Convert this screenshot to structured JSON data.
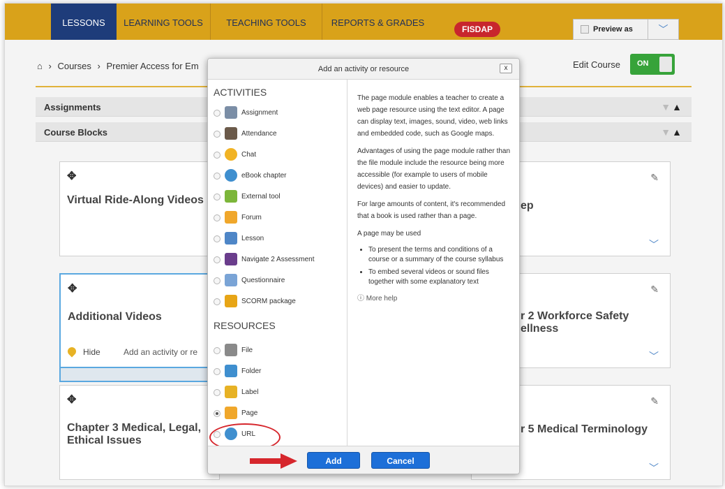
{
  "nav": {
    "tabs": [
      "LESSONS",
      "LEARNING TOOLS",
      "TEACHING TOOLS",
      "REPORTS & GRADES"
    ],
    "fisdap": "FISDAP",
    "preview_label": "Preview as",
    "dropdown_glyph": "﹀"
  },
  "breadcrumb": {
    "home_glyph": "⌂",
    "sep": "›",
    "items": [
      "Courses",
      "Premier Access for Em"
    ]
  },
  "edit_course": {
    "label": "Edit Course",
    "state": "ON"
  },
  "sections": {
    "assignments": "Assignments",
    "course_blocks": "Course Blocks"
  },
  "cards": [
    {
      "title": "Virtual Ride-Along Videos"
    },
    {
      "title": "Additional Videos",
      "hide_label": "Hide",
      "add_label": "Add an activity or re"
    },
    {
      "title": "Chapter 3 Medical, Legal,\nEthical Issues"
    },
    {
      "title": "ep"
    },
    {
      "title": "r 2 Workforce Safety\nellness"
    },
    {
      "title": "r 5 Medical Terminology"
    }
  ],
  "modal": {
    "title": "Add an activity or resource",
    "close": "x",
    "activities_heading": "ACTIVITIES",
    "resources_heading": "RESOURCES",
    "activities": [
      {
        "label": "Assignment",
        "icon": "assignment-icon",
        "color": "#7b8ea6"
      },
      {
        "label": "Attendance",
        "icon": "attendance-icon",
        "color": "#6b5a4a"
      },
      {
        "label": "Chat",
        "icon": "chat-icon",
        "color": "#f1b324"
      },
      {
        "label": "eBook chapter",
        "icon": "ebook-icon",
        "color": "#3f8fcf"
      },
      {
        "label": "External tool",
        "icon": "puzzle-icon",
        "color": "#7cb63a"
      },
      {
        "label": "Forum",
        "icon": "forum-icon",
        "color": "#f0a72b"
      },
      {
        "label": "Lesson",
        "icon": "lesson-icon",
        "color": "#4e86c7"
      },
      {
        "label": "Navigate 2 Assessment",
        "icon": "navigate-icon",
        "color": "#6a3d8c"
      },
      {
        "label": "Questionnaire",
        "icon": "questionnaire-icon",
        "color": "#7aa4d6"
      },
      {
        "label": "SCORM package",
        "icon": "scorm-icon",
        "color": "#e7a516"
      }
    ],
    "resources": [
      {
        "label": "File",
        "icon": "file-icon",
        "color": "#8a8a8a"
      },
      {
        "label": "Folder",
        "icon": "folder-icon",
        "color": "#3f8fcf"
      },
      {
        "label": "Label",
        "icon": "label-icon",
        "color": "#e7b225"
      },
      {
        "label": "Page",
        "icon": "page-icon",
        "color": "#f0a72b",
        "selected": true
      },
      {
        "label": "URL",
        "icon": "url-icon",
        "color": "#3f8fcf"
      }
    ],
    "description": {
      "p1": "The page module enables a teacher to create a web page resource using the text editor. A page can display text, images, sound, video, web links and embedded code, such as Google maps.",
      "p2": "Advantages of using the page module rather than the file module include the resource being more accessible (for example to users of mobile devices) and easier to update.",
      "p3": "For large amounts of content, it's recommended that a book is used rather than a page.",
      "p4": "A page may be used",
      "bullets": [
        "To present the terms and conditions of a course or a summary of the course syllabus",
        "To embed several videos or sound files together with some explanatory text"
      ],
      "more_help": "More help",
      "help_glyph": "ⓘ"
    },
    "add_button": "Add",
    "cancel_button": "Cancel"
  },
  "colors": {
    "nav_bg": "#d9a21a",
    "nav_active": "#1e3c7a",
    "primary_button": "#1d6fd8",
    "toggle_on": "#37a33a",
    "highlight_red": "#d6262c"
  },
  "glyphs": {
    "move": "✥",
    "pencil": "✎",
    "chevron": "﹀",
    "up": "▲",
    "down": "▼"
  }
}
